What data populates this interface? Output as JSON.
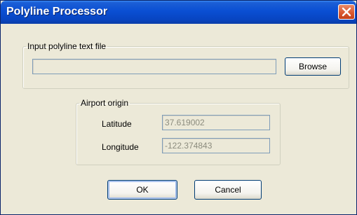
{
  "window": {
    "title": "Polyline Processor"
  },
  "input_group": {
    "legend": "Input polyline text file",
    "path_value": "",
    "browse_label": "Browse"
  },
  "airport_group": {
    "legend": "Airport origin",
    "latitude_label": "Latitude",
    "latitude_value": "37.619002",
    "longitude_label": "Longitude",
    "longitude_value": "-122.374843"
  },
  "footer": {
    "ok_label": "OK",
    "cancel_label": "Cancel"
  },
  "colors": {
    "titlebar": "#0a4fd3",
    "dialog_bg": "#ece9d8",
    "close_button": "#d9562e"
  },
  "icons": {
    "close": "close-icon"
  }
}
